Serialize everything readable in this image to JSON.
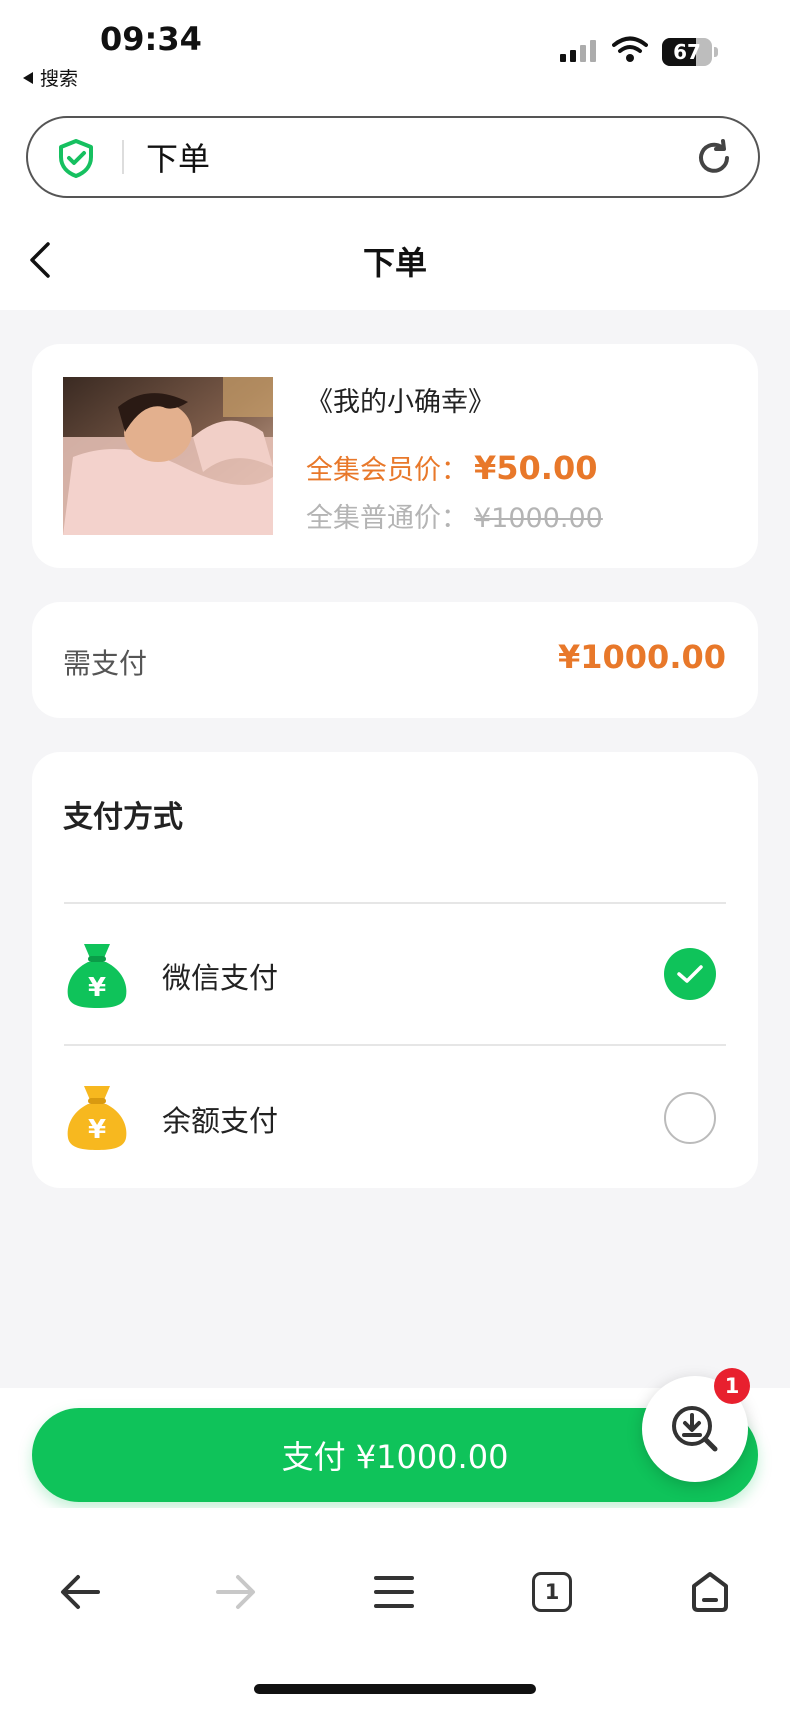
{
  "status_bar": {
    "time": "09:34",
    "back_app": "搜索",
    "battery": "67",
    "battery_level": 0.67
  },
  "browser": {
    "url_title": "下单"
  },
  "header": {
    "title": "下单"
  },
  "product": {
    "name": "《我的小确幸》",
    "member_label": "全集会员价：",
    "member_price": "¥50.00",
    "normal_label": "全集普通价：",
    "normal_price": "¥1000.00"
  },
  "payment_due": {
    "label": "需支付",
    "amount": "¥1000.00"
  },
  "payment_methods": {
    "title": "支付方式",
    "options": [
      {
        "label": "微信支付",
        "icon": "money-bag-icon",
        "color": "#0fc35a",
        "selected": true
      },
      {
        "label": "余额支付",
        "icon": "money-bag-icon",
        "color": "#f7b81f",
        "selected": false
      }
    ]
  },
  "pay_button": {
    "label": "支付 ¥1000.00"
  },
  "download_fab": {
    "badge": "1",
    "icon": "download-search-icon"
  },
  "toolbar": {
    "tab_count": "1",
    "items": [
      "back-arrow-icon",
      "forward-arrow-icon",
      "menu-icon",
      "tabs-icon",
      "home-icon"
    ]
  },
  "colors": {
    "accent_green": "#0fc35a",
    "price_orange": "#e8782a",
    "yellow": "#f7b81f"
  }
}
